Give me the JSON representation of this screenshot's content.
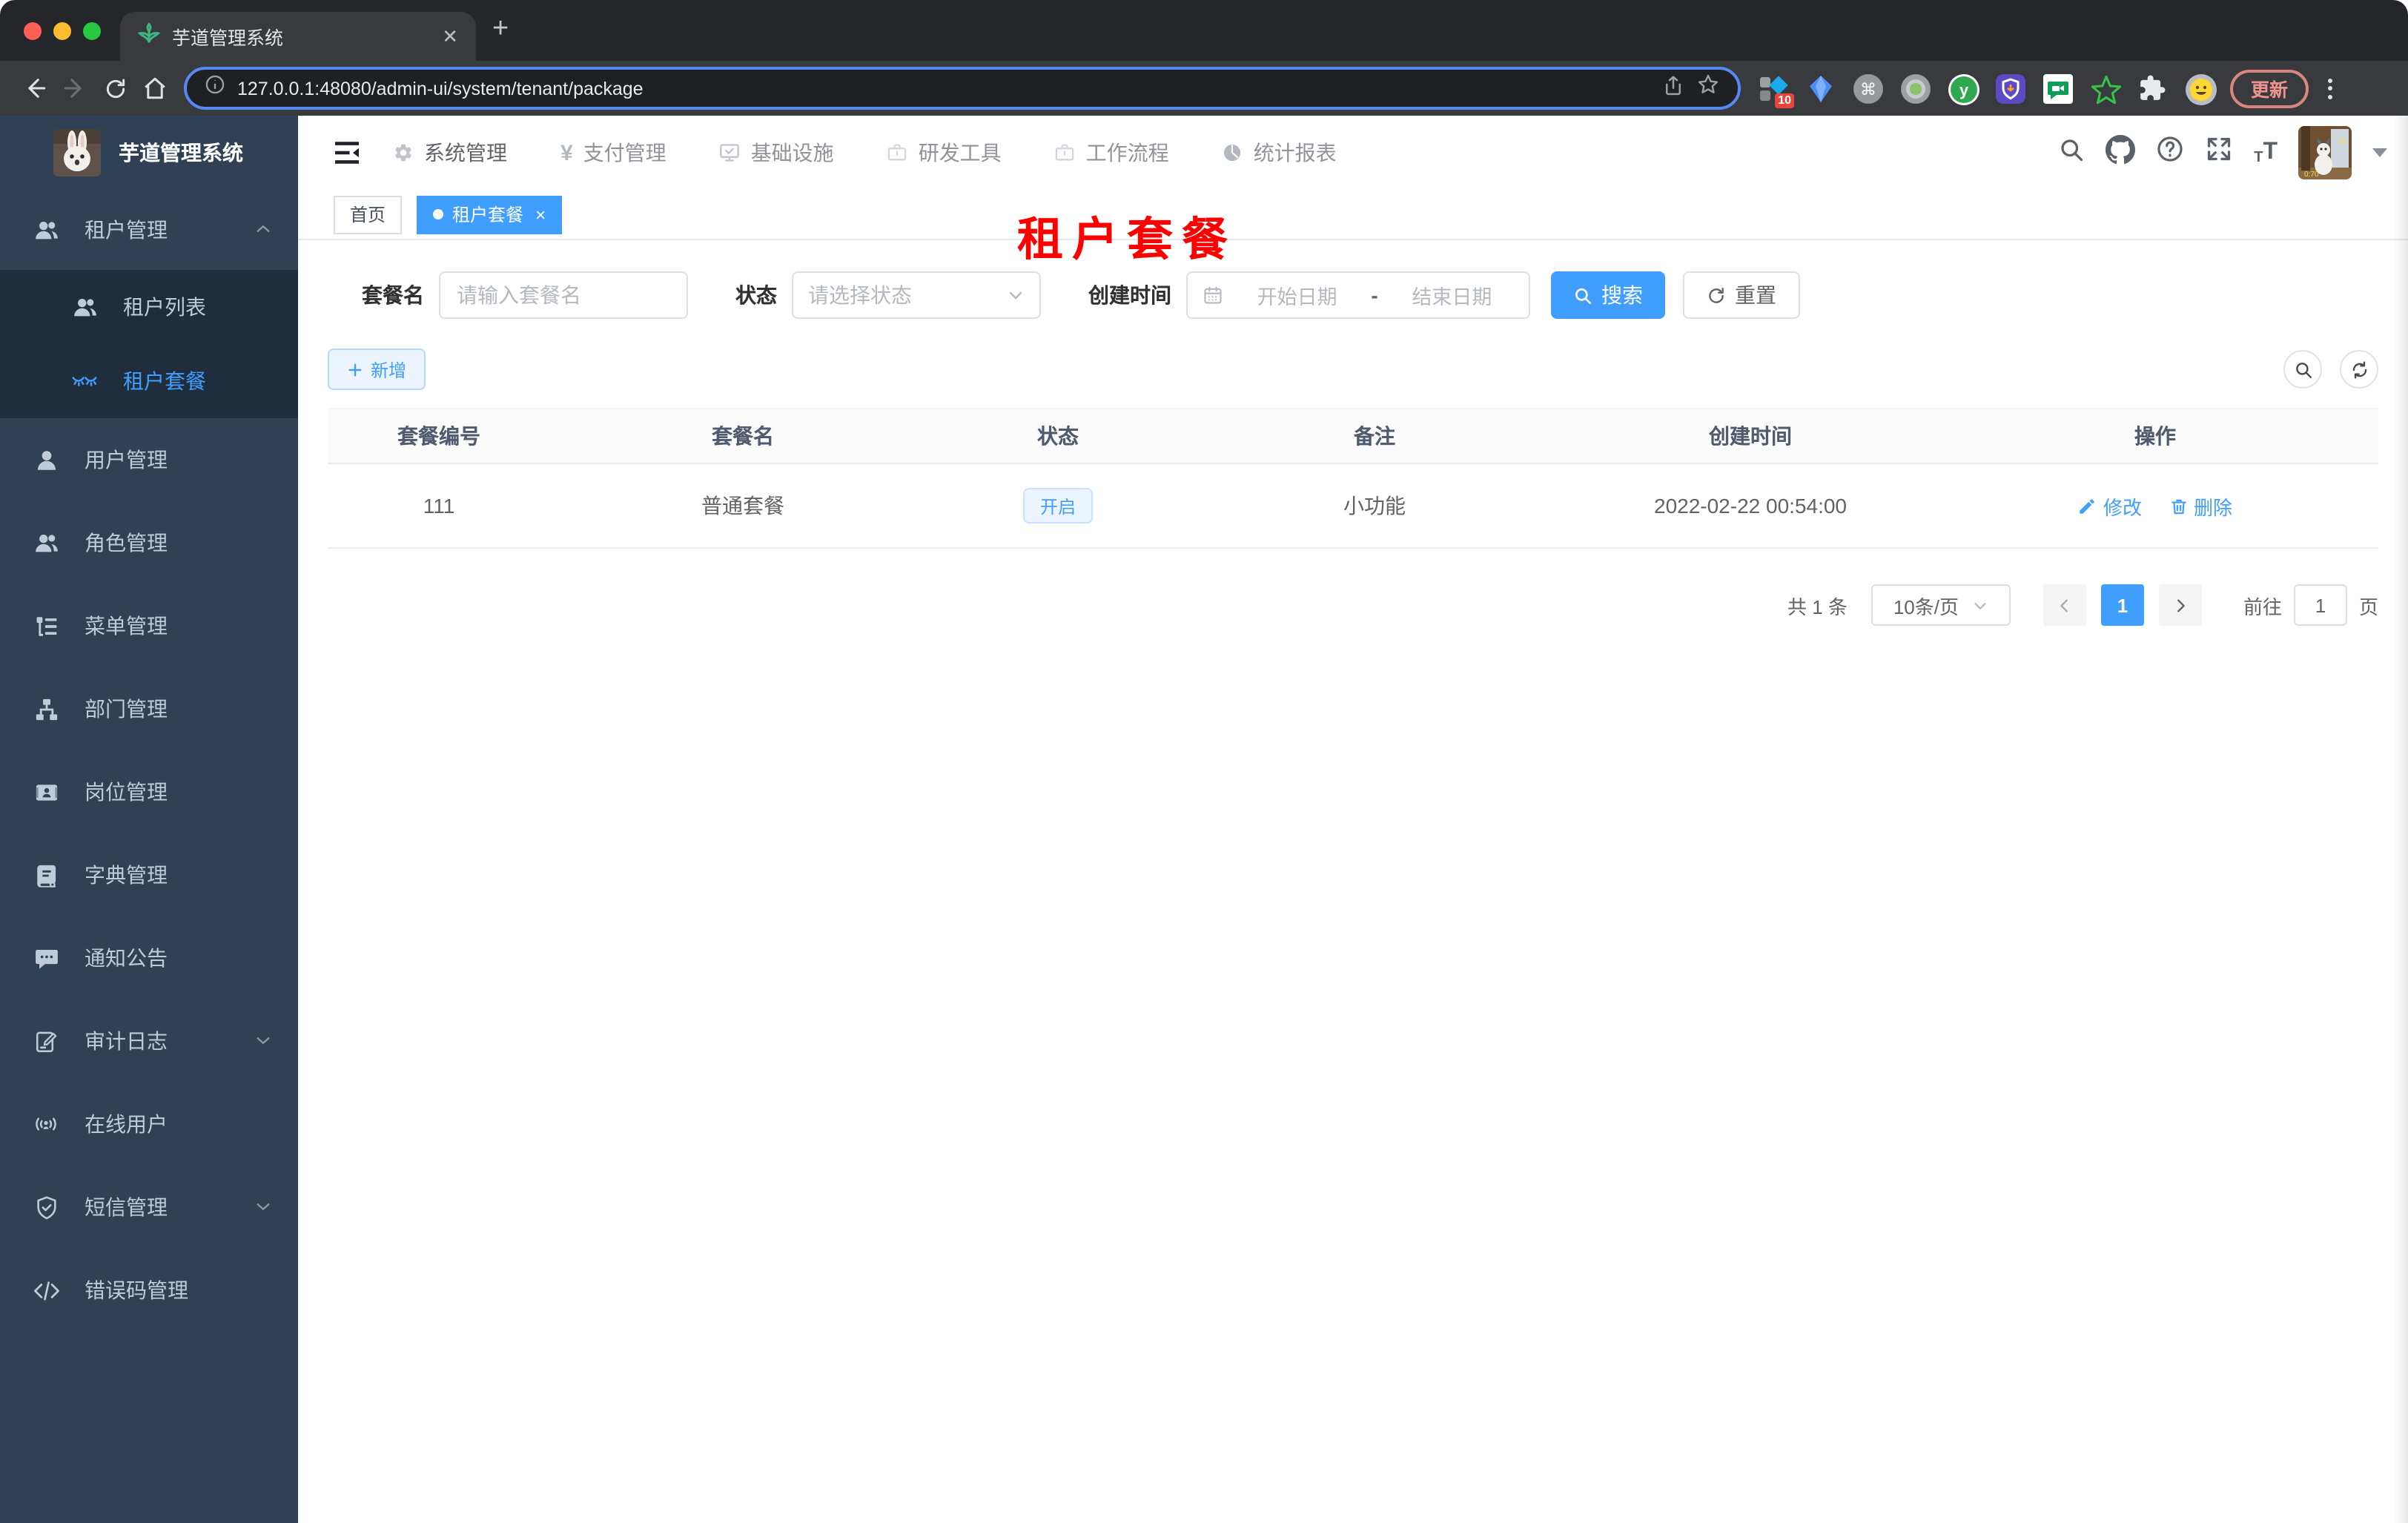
{
  "browser": {
    "tab_title": "芋道管理系统",
    "url": "127.0.0.1:48080/admin-ui/system/tenant/package",
    "update_label": "更新",
    "extension_badge": "10"
  },
  "topnav": {
    "items": [
      {
        "label": "系统管理"
      },
      {
        "label": "支付管理"
      },
      {
        "label": "基础设施"
      },
      {
        "label": "研发工具"
      },
      {
        "label": "工作流程"
      },
      {
        "label": "统计报表"
      }
    ]
  },
  "sidebar": {
    "title": "芋道管理系统",
    "items": [
      {
        "label": "租户管理"
      },
      {
        "label": "租户列表"
      },
      {
        "label": "租户套餐"
      },
      {
        "label": "用户管理"
      },
      {
        "label": "角色管理"
      },
      {
        "label": "菜单管理"
      },
      {
        "label": "部门管理"
      },
      {
        "label": "岗位管理"
      },
      {
        "label": "字典管理"
      },
      {
        "label": "通知公告"
      },
      {
        "label": "审计日志"
      },
      {
        "label": "在线用户"
      },
      {
        "label": "短信管理"
      },
      {
        "label": "错误码管理"
      }
    ]
  },
  "tags": {
    "items": [
      {
        "label": "首页"
      },
      {
        "label": "租户套餐"
      }
    ]
  },
  "overlay": {
    "title": "租户套餐"
  },
  "filters": {
    "name_label": "套餐名",
    "name_placeholder": "请输入套餐名",
    "status_label": "状态",
    "status_placeholder": "请选择状态",
    "date_label": "创建时间",
    "date_start": "开始日期",
    "date_separator": "-",
    "date_end": "结束日期",
    "search_label": "搜索",
    "reset_label": "重置"
  },
  "toolbar": {
    "add_label": "新增"
  },
  "table": {
    "headers": [
      "套餐编号",
      "套餐名",
      "状态",
      "备注",
      "创建时间",
      "操作"
    ],
    "rows": [
      {
        "id": "111",
        "name": "普通套餐",
        "status": "开启",
        "remark": "小功能",
        "created": "2022-02-22 00:54:00",
        "actions": [
          "修改",
          "删除"
        ]
      }
    ]
  },
  "pagination": {
    "total": "共 1 条",
    "page_size": "10条/页",
    "current_page": "1",
    "goto_label": "前往",
    "goto_value": "1",
    "page_unit": "页"
  },
  "colors": {
    "primary": "#409EFF",
    "sidebar_bg": "#304156",
    "submenu_bg": "#1f2d3d",
    "annotation_red": "#FF0000"
  }
}
